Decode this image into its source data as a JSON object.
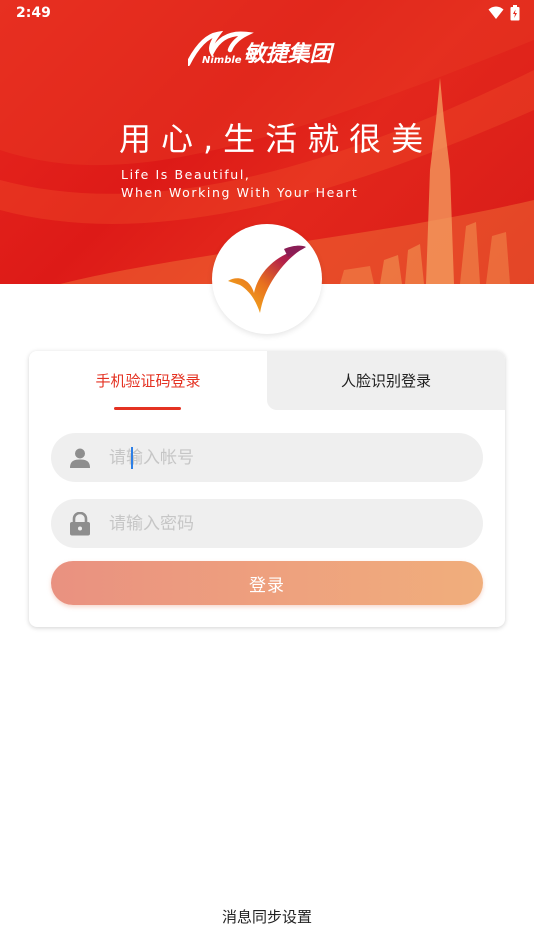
{
  "status_bar": {
    "time": "2:49"
  },
  "brand": {
    "latin": "Nimble",
    "name": "敏捷集团"
  },
  "hero": {
    "slogan_cn": "用心,生活就很美",
    "slogan_en_line1": "Life Is Beautiful,",
    "slogan_en_line2": "When Working With Your Heart"
  },
  "login": {
    "tabs": [
      {
        "label": "手机验证码登录",
        "active": true
      },
      {
        "label": "人脸识别登录",
        "active": false
      }
    ],
    "account_placeholder": "请输入帐号",
    "password_placeholder": "请输入密码",
    "submit_label": "登录"
  },
  "footer": {
    "sync_settings_label": "消息同步设置"
  },
  "colors": {
    "hero_red": "#e3271c",
    "accent_red": "#e43222",
    "button_gradient_start": "#e99180",
    "button_gradient_end": "#f0ae7c"
  }
}
